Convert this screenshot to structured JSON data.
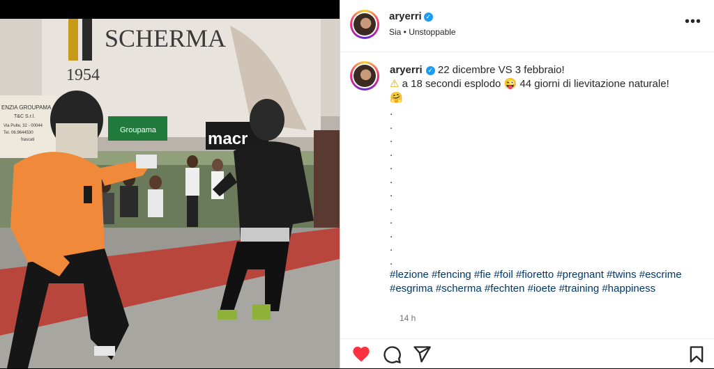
{
  "post": {
    "username": "aryerri",
    "verified_mark": "✓",
    "subtitle": "Sia • Unstoppable",
    "more_label": "•••",
    "caption": {
      "line1": "22 dicembre VS 3 febbraio!",
      "warning_emoji": "⚠",
      "line2a": "a 18 secondi esplodo",
      "tongue_emoji": "😜",
      "line2b": "44 giorni di lievitazione naturale!",
      "hug_emoji": "🤗",
      "dots": [
        ".",
        ".",
        ".",
        ".",
        ".",
        ".",
        ".",
        ".",
        ".",
        ".",
        ".",
        "."
      ],
      "hashtags_line1": "#lezione #fencing #fie #foil #fioretto #pregnant #twins #escrime",
      "hashtags_line2": "#esgrima #scherma #fechten #ioete #training #happiness"
    },
    "time": "14 h"
  },
  "media": {
    "banner_text": "SCHERMA",
    "banner_year": "1954",
    "sponsor_1": "Groupama",
    "sponsor_2": "macr",
    "sign_text_1": "ENZIA GROUPAMA",
    "sign_text_2": "T&C S.r.l.",
    "sign_text_3": "Via Pulte, 32 - 00044",
    "sign_text_4": "Tel. 06.9644530",
    "sign_text_5": "frascati"
  },
  "actions": {
    "like_icon": "heart-filled",
    "comment_icon": "comment",
    "share_icon": "paper-plane",
    "save_icon": "bookmark"
  },
  "colors": {
    "like": "#ff3040",
    "hashtag": "#00376b",
    "verified": "#1d9bf0"
  }
}
